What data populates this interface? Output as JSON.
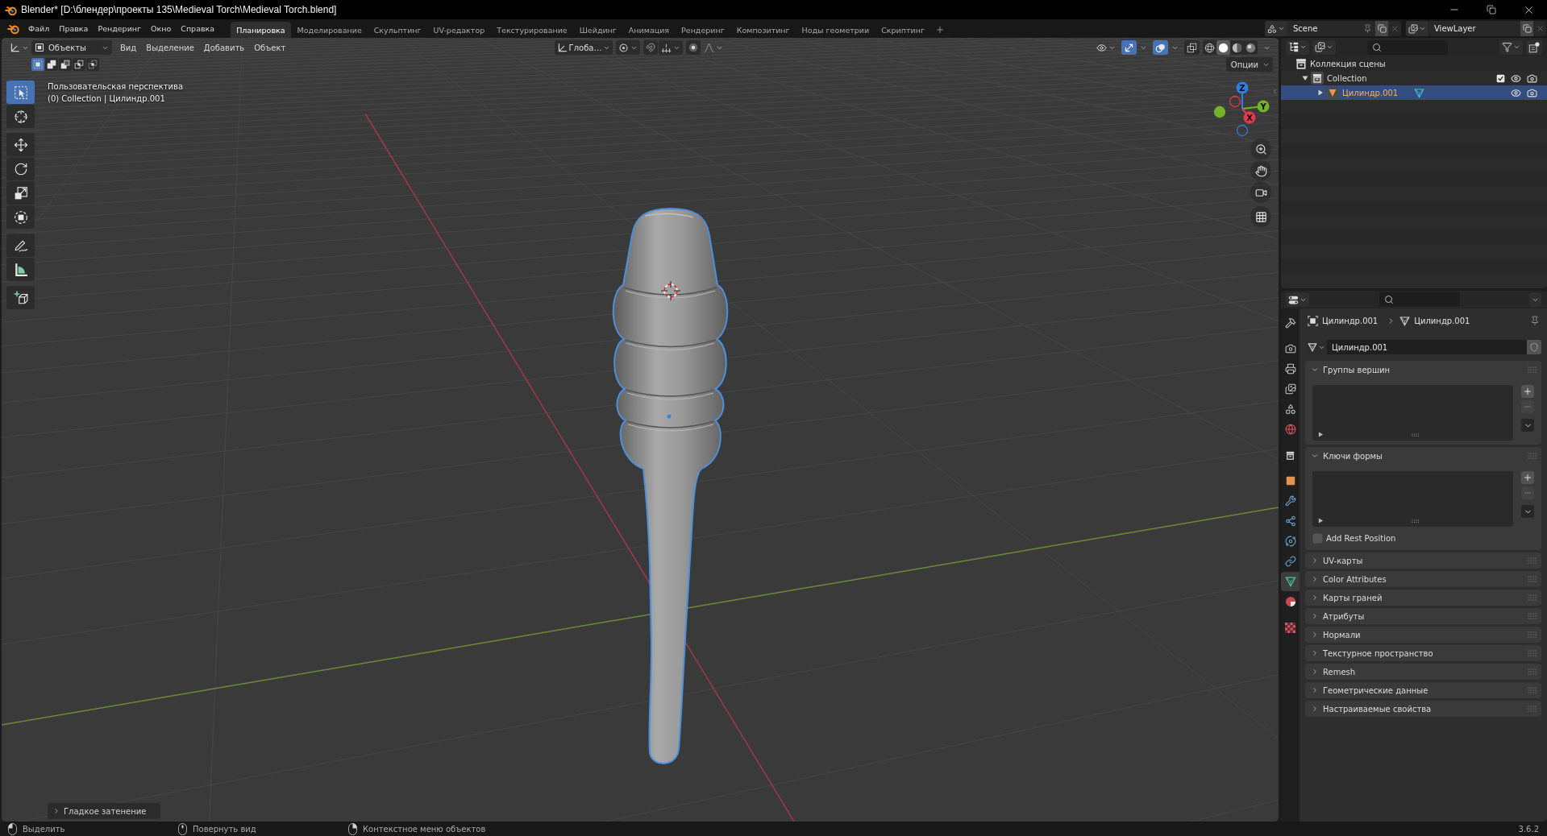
{
  "window": {
    "title": "Blender* [D:\\блендер\\проекты 135\\Medieval Torch\\Medieval Torch.blend]"
  },
  "top_bar": {
    "menus": [
      "Файл",
      "Правка",
      "Рендеринг",
      "Окно",
      "Справка"
    ],
    "workspaces": [
      {
        "label": "Планировка",
        "selected": true
      },
      {
        "label": "Моделирование",
        "selected": false
      },
      {
        "label": "Скульптинг",
        "selected": false
      },
      {
        "label": "UV-редактор",
        "selected": false
      },
      {
        "label": "Текстурирование",
        "selected": false
      },
      {
        "label": "Шейдинг",
        "selected": false
      },
      {
        "label": "Анимация",
        "selected": false
      },
      {
        "label": "Рендеринг",
        "selected": false
      },
      {
        "label": "Композитинг",
        "selected": false
      },
      {
        "label": "Ноды геометрии",
        "selected": false
      },
      {
        "label": "Скриптинг",
        "selected": false
      }
    ],
    "scene": "Scene",
    "view_layer": "ViewLayer"
  },
  "viewport": {
    "header": {
      "mode": "Объекты",
      "menus": [
        "Вид",
        "Выделение",
        "Добавить",
        "Объект"
      ],
      "orientation": "Глоба…",
      "snap": false,
      "proportional": false,
      "gizmos": true,
      "overlays": true,
      "xray": false,
      "shading": [
        {
          "selected": false
        },
        {
          "selected": true
        },
        {
          "selected": false
        },
        {
          "selected": false
        }
      ]
    },
    "select_modes": [
      {
        "selected": true
      },
      {
        "selected": false
      },
      {
        "selected": false
      },
      {
        "selected": false
      },
      {
        "selected": false
      }
    ],
    "options": "Опции",
    "info": [
      "Пользовательская перспектива",
      "(0) Collection | Цилиндр.001"
    ],
    "tool_groups": [
      [
        {
          "selected": true
        },
        {
          "selected": false
        }
      ],
      [
        {
          "selected": false
        },
        {
          "selected": false
        },
        {
          "selected": false
        },
        {
          "selected": false
        }
      ],
      [
        {
          "selected": false
        },
        {
          "selected": false
        }
      ],
      [
        {
          "selected": false
        }
      ]
    ],
    "gizmo": [
      {
        "label": "Z",
        "color": "#2f7fe3"
      },
      {
        "label": "Y",
        "color": "#74b22a"
      },
      {
        "label": "X",
        "color": "#e5384f"
      }
    ],
    "last_operator": {
      "label": "Гладкое затенение",
      "expanded": false
    }
  },
  "outliner": {
    "tree": [
      {
        "label": "Коллекция сцены",
        "kind": "scene_collection",
        "selected": false,
        "children": [
          {
            "label": "Collection",
            "kind": "collection",
            "expanded": true,
            "checked": true,
            "selected": false,
            "children": [
              {
                "label": "Цилиндр.001",
                "kind": "object",
                "expanded": false,
                "selected": true
              }
            ]
          }
        ]
      }
    ]
  },
  "properties": {
    "tab_groups": [
      [
        {
          "selected": false
        }
      ],
      [
        {
          "selected": false
        },
        {
          "selected": false
        },
        {
          "selected": false
        },
        {
          "selected": false
        },
        {
          "selected": false
        }
      ],
      [
        {
          "selected": false
        }
      ],
      [
        {
          "selected": false
        },
        {
          "selected": false
        },
        {
          "selected": false
        },
        {
          "selected": false
        },
        {
          "selected": false
        },
        {
          "selected": true
        },
        {
          "selected": false
        }
      ],
      [
        {
          "selected": false
        }
      ]
    ],
    "breadcrumb": [
      "Цилиндр.001",
      "Цилиндр.001"
    ],
    "mesh": "Цилиндр.001",
    "panels": [
      {
        "title": "Группы вершин",
        "kind": "list",
        "expanded": true
      },
      {
        "title": "Ключи формы",
        "kind": "list",
        "expanded": true,
        "checkbox": {
          "label": "Add Rest Position",
          "checked": false
        }
      },
      {
        "title": "UV-карты",
        "expanded": false
      },
      {
        "title": "Color Attributes",
        "expanded": false
      },
      {
        "title": "Карты граней",
        "expanded": false
      },
      {
        "title": "Атрибуты",
        "expanded": false
      },
      {
        "title": "Нормали",
        "expanded": false
      },
      {
        "title": "Текстурное пространство",
        "expanded": false
      },
      {
        "title": "Remesh",
        "expanded": false
      },
      {
        "title": "Геометрические данные",
        "expanded": false
      },
      {
        "title": "Настраиваемые свойства",
        "expanded": false
      }
    ]
  },
  "status_bar": {
    "hints": [
      "Выделить",
      "Повернуть вид",
      "Контекстное меню объектов"
    ],
    "version": "3.6.2"
  }
}
